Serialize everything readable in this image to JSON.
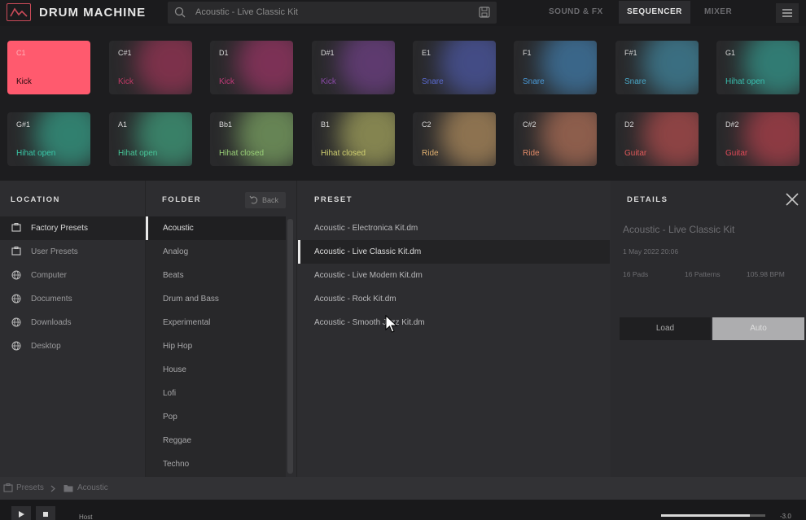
{
  "app": {
    "title": "DRUM MACHINE"
  },
  "search": {
    "value": "Acoustic - Live Classic Kit"
  },
  "nav": {
    "tabs": [
      "SOUND & FX",
      "SEQUENCER",
      "MIXER"
    ],
    "active": "SEQUENCER"
  },
  "pads": [
    {
      "note": "C1",
      "name": "Kick",
      "color": "#ff5a6e"
    },
    {
      "note": "C#1",
      "name": "Kick",
      "color": "#c23a66"
    },
    {
      "note": "D1",
      "name": "Kick",
      "color": "#c23a7a"
    },
    {
      "note": "D#1",
      "name": "Kick",
      "color": "#8a4aa8"
    },
    {
      "note": "E1",
      "name": "Snare",
      "color": "#5a6ad0"
    },
    {
      "note": "F1",
      "name": "Snare",
      "color": "#4a9ad8"
    },
    {
      "note": "F#1",
      "name": "Snare",
      "color": "#4aa8c8"
    },
    {
      "note": "G1",
      "name": "Hihat open",
      "color": "#3ac0b0"
    },
    {
      "note": "G#1",
      "name": "Hihat open",
      "color": "#3ac8a8"
    },
    {
      "note": "A1",
      "name": "Hihat open",
      "color": "#48c89a"
    },
    {
      "note": "Bb1",
      "name": "Hihat closed",
      "color": "#9ad078"
    },
    {
      "note": "B1",
      "name": "Hihat closed",
      "color": "#d0d070"
    },
    {
      "note": "C2",
      "name": "Ride",
      "color": "#e0b070"
    },
    {
      "note": "C#2",
      "name": "Ride",
      "color": "#e08a68"
    },
    {
      "note": "D2",
      "name": "Guitar",
      "color": "#e05a5a"
    },
    {
      "note": "D#2",
      "name": "Guitar",
      "color": "#e04a58"
    }
  ],
  "browser": {
    "headers": {
      "location": "LOCATION",
      "folder": "FOLDER",
      "preset": "PRESET",
      "details": "DETAILS"
    },
    "back_label": "Back",
    "locations": [
      "Factory Presets",
      "User Presets",
      "Computer",
      "Documents",
      "Downloads",
      "Desktop"
    ],
    "folders": [
      "Acoustic",
      "Analog",
      "Beats",
      "Drum and Bass",
      "Experimental",
      "Hip Hop",
      "House",
      "Lofi",
      "Pop",
      "Reggae",
      "Techno"
    ],
    "presets": [
      "Acoustic - Electronica Kit.dm",
      "Acoustic - Live Classic Kit.dm",
      "Acoustic - Live Modern Kit.dm",
      "Acoustic - Rock Kit.dm",
      "Acoustic - Smooth Jazz Kit.dm"
    ]
  },
  "details": {
    "title": "Acoustic - Live Classic Kit",
    "date": "1 May 2022 20:06",
    "pads": "16 Pads",
    "patterns": "16 Patterns",
    "bpm": "105.98 BPM",
    "load_label": "Load",
    "auto_label": "Auto"
  },
  "breadcrumb": {
    "root": "Presets",
    "folder": "Acoustic"
  },
  "transport": {
    "host_label": "Host",
    "volume_value": "-3.0",
    "volume_fraction": 0.85
  }
}
